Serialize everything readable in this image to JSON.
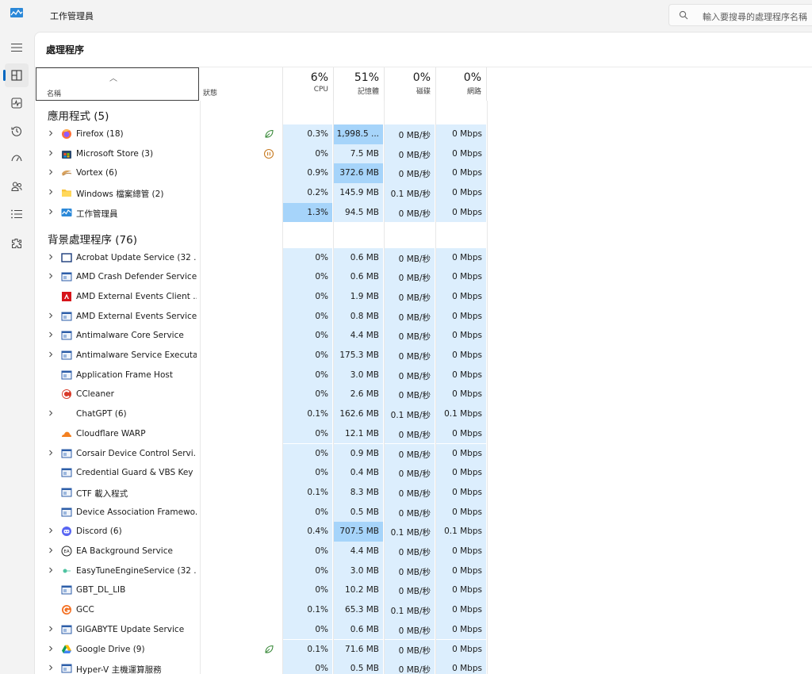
{
  "window": {
    "title": "工作管理員"
  },
  "search": {
    "placeholder": "輸入要搜尋的處理程序名稱"
  },
  "nav": [
    "處理程序",
    "效能",
    "應用程式歷程記錄",
    "開機應用程式",
    "使用者",
    "詳細資料",
    "服務"
  ],
  "page_title": "處理程序",
  "columns": {
    "name": "名稱",
    "status": "狀態",
    "cpu": {
      "pct": "6%",
      "label": "CPU"
    },
    "memory": {
      "pct": "51%",
      "label": "記憶體"
    },
    "disk": {
      "pct": "0%",
      "label": "磁碟"
    },
    "network": {
      "pct": "0%",
      "label": "網路"
    }
  },
  "groups": [
    {
      "title": "應用程式 (5)",
      "rows": [
        {
          "name": "Firefox (18)",
          "icon": "firefox-icon",
          "expand": true,
          "status": "efficiency-leaf-icon",
          "cpu": "0.3%",
          "mem": "1,998.5 ...",
          "disk": "0 MB/秒",
          "net": "0 Mbps",
          "memHeat": 2
        },
        {
          "name": "Microsoft Store (3)",
          "icon": "store-icon",
          "expand": true,
          "status": "pause-icon",
          "cpu": "0%",
          "mem": "7.5 MB",
          "disk": "0 MB/秒",
          "net": "0 Mbps"
        },
        {
          "name": "Vortex (6)",
          "icon": "vortex-icon",
          "expand": true,
          "cpu": "0.9%",
          "mem": "372.6 MB",
          "disk": "0 MB/秒",
          "net": "0 Mbps",
          "memHeat": 2
        },
        {
          "name": "Windows 檔案總管 (2)",
          "icon": "folder-icon",
          "expand": true,
          "cpu": "0.2%",
          "mem": "145.9 MB",
          "disk": "0.1 MB/秒",
          "net": "0 Mbps"
        },
        {
          "name": "工作管理員",
          "icon": "taskmgr-icon",
          "expand": true,
          "cpu": "1.3%",
          "mem": "94.5 MB",
          "disk": "0 MB/秒",
          "net": "0 Mbps",
          "cpuHeat": 2
        }
      ]
    },
    {
      "title": "背景處理程序 (76)",
      "rows": [
        {
          "name": "Acrobat Update Service (32 ...",
          "icon": "window-icon",
          "expand": true,
          "cpu": "0%",
          "mem": "0.6 MB",
          "disk": "0 MB/秒",
          "net": "0 Mbps"
        },
        {
          "name": "AMD Crash Defender Service",
          "icon": "service-icon",
          "expand": true,
          "cpu": "0%",
          "mem": "0.6 MB",
          "disk": "0 MB/秒",
          "net": "0 Mbps"
        },
        {
          "name": "AMD External Events Client ...",
          "icon": "amd-icon",
          "expand": false,
          "cpu": "0%",
          "mem": "1.9 MB",
          "disk": "0 MB/秒",
          "net": "0 Mbps"
        },
        {
          "name": "AMD External Events Service...",
          "icon": "service-icon",
          "expand": true,
          "cpu": "0%",
          "mem": "0.8 MB",
          "disk": "0 MB/秒",
          "net": "0 Mbps"
        },
        {
          "name": "Antimalware Core Service",
          "icon": "service-icon",
          "expand": true,
          "cpu": "0%",
          "mem": "4.4 MB",
          "disk": "0 MB/秒",
          "net": "0 Mbps"
        },
        {
          "name": "Antimalware Service Executa...",
          "icon": "service-icon",
          "expand": true,
          "cpu": "0%",
          "mem": "175.3 MB",
          "disk": "0 MB/秒",
          "net": "0 Mbps"
        },
        {
          "name": "Application Frame Host",
          "icon": "service-icon",
          "expand": false,
          "cpu": "0%",
          "mem": "3.0 MB",
          "disk": "0 MB/秒",
          "net": "0 Mbps"
        },
        {
          "name": "CCleaner",
          "icon": "ccleaner-icon",
          "expand": false,
          "cpu": "0%",
          "mem": "2.6 MB",
          "disk": "0 MB/秒",
          "net": "0 Mbps"
        },
        {
          "name": "ChatGPT (6)",
          "icon": "",
          "expand": true,
          "cpu": "0.1%",
          "mem": "162.6 MB",
          "disk": "0.1 MB/秒",
          "net": "0.1 Mbps"
        },
        {
          "name": "Cloudflare WARP",
          "icon": "cloudflare-icon",
          "expand": false,
          "cpu": "0%",
          "mem": "12.1 MB",
          "disk": "0 MB/秒",
          "net": "0 Mbps"
        },
        {
          "name": "Corsair Device Control Servi...",
          "icon": "service-icon",
          "expand": true,
          "cpu": "0%",
          "mem": "0.9 MB",
          "disk": "0 MB/秒",
          "net": "0 Mbps"
        },
        {
          "name": "Credential Guard & VBS Key ...",
          "icon": "service-icon",
          "expand": false,
          "cpu": "0%",
          "mem": "0.4 MB",
          "disk": "0 MB/秒",
          "net": "0 Mbps"
        },
        {
          "name": "CTF 載入程式",
          "icon": "service-icon",
          "expand": false,
          "cpu": "0.1%",
          "mem": "8.3 MB",
          "disk": "0 MB/秒",
          "net": "0 Mbps"
        },
        {
          "name": "Device Association Framewo...",
          "icon": "service-icon",
          "expand": false,
          "cpu": "0%",
          "mem": "0.5 MB",
          "disk": "0 MB/秒",
          "net": "0 Mbps"
        },
        {
          "name": "Discord (6)",
          "icon": "discord-icon",
          "expand": true,
          "cpu": "0.4%",
          "mem": "707.5 MB",
          "disk": "0.1 MB/秒",
          "net": "0.1 Mbps",
          "memHeat": 2
        },
        {
          "name": "EA Background Service",
          "icon": "ea-icon",
          "expand": true,
          "cpu": "0%",
          "mem": "4.4 MB",
          "disk": "0 MB/秒",
          "net": "0 Mbps"
        },
        {
          "name": "EasyTuneEngineService (32 ...",
          "icon": "easytune-icon",
          "expand": true,
          "cpu": "0%",
          "mem": "3.0 MB",
          "disk": "0 MB/秒",
          "net": "0 Mbps"
        },
        {
          "name": "GBT_DL_LIB",
          "icon": "service-icon",
          "expand": false,
          "cpu": "0%",
          "mem": "10.2 MB",
          "disk": "0 MB/秒",
          "net": "0 Mbps"
        },
        {
          "name": "GCC",
          "icon": "gcc-icon",
          "expand": false,
          "cpu": "0.1%",
          "mem": "65.3 MB",
          "disk": "0.1 MB/秒",
          "net": "0 Mbps"
        },
        {
          "name": "GIGABYTE Update Service",
          "icon": "service-icon",
          "expand": true,
          "cpu": "0%",
          "mem": "0.6 MB",
          "disk": "0 MB/秒",
          "net": "0 Mbps"
        },
        {
          "name": "Google Drive (9)",
          "icon": "gdrive-icon",
          "expand": true,
          "status": "efficiency-leaf-icon",
          "cpu": "0.1%",
          "mem": "71.6 MB",
          "disk": "0 MB/秒",
          "net": "0 Mbps"
        },
        {
          "name": "Hyper-V 主機運算服務",
          "icon": "service-icon",
          "expand": true,
          "cpu": "0%",
          "mem": "0.5 MB",
          "disk": "0 MB/秒",
          "net": "0 Mbps"
        }
      ]
    }
  ],
  "colors": {
    "cell": "#dceefd",
    "heat": "#a6d4fa",
    "accent": "#0067c0"
  }
}
